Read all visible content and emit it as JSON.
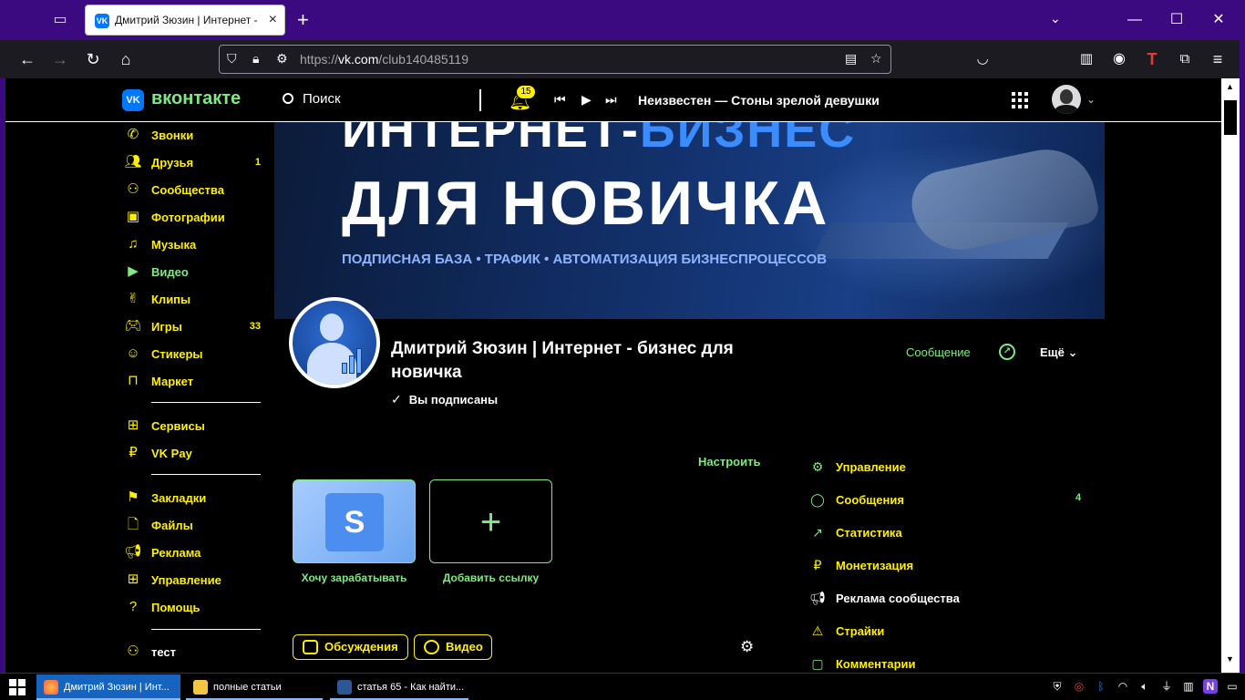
{
  "browser": {
    "tab_title": "Дмитрий Зюзин | Интернет - б",
    "new_tab": "+",
    "url_prefix": "https://",
    "url_host": "vk.com",
    "url_path": "/club140485119"
  },
  "vk": {
    "logo_text": "вконтакте",
    "search_placeholder": "Поиск",
    "notifications_count": "15",
    "now_playing": "Неизвестен — Стоны зрелой девушки"
  },
  "sidebar": {
    "items": [
      {
        "label": "Звонки",
        "icon": "phone-icon",
        "count": ""
      },
      {
        "label": "Друзья",
        "icon": "friends-icon",
        "count": "1"
      },
      {
        "label": "Сообщества",
        "icon": "communities-icon",
        "count": ""
      },
      {
        "label": "Фотографии",
        "icon": "photos-icon",
        "count": ""
      },
      {
        "label": "Музыка",
        "icon": "music-icon",
        "count": ""
      },
      {
        "label": "Видео",
        "icon": "video-icon",
        "count": ""
      },
      {
        "label": "Клипы",
        "icon": "clips-icon",
        "count": ""
      },
      {
        "label": "Игры",
        "icon": "games-icon",
        "count": "33"
      },
      {
        "label": "Стикеры",
        "icon": "stickers-icon",
        "count": ""
      },
      {
        "label": "Маркет",
        "icon": "market-icon",
        "count": ""
      }
    ],
    "items2": [
      {
        "label": "Сервисы",
        "icon": "services-icon"
      },
      {
        "label": "VK Pay",
        "icon": "vkpay-icon"
      }
    ],
    "items3": [
      {
        "label": "Закладки",
        "icon": "bookmarks-icon"
      },
      {
        "label": "Файлы",
        "icon": "files-icon"
      },
      {
        "label": "Реклама",
        "icon": "ads-icon"
      },
      {
        "label": "Управление",
        "icon": "manage-icon"
      },
      {
        "label": "Помощь",
        "icon": "help-icon"
      }
    ],
    "items4": [
      {
        "label": "тест",
        "icon": "group-icon"
      }
    ]
  },
  "cover": {
    "line1a": "ИНТЕРНЕТ-",
    "line1b": "БИЗНЕС",
    "line2": "ДЛЯ НОВИЧКА",
    "line3": "ПОДПИСНАЯ БАЗА • ТРАФИК • АВТОМАТИЗАЦИЯ БИЗНЕСПРОЦЕССОВ"
  },
  "group": {
    "name": "Дмитрий Зюзин | Интернет - бизнес для новичка",
    "subscribed": "Вы подписаны",
    "message_btn": "Сообщение",
    "more_btn": "Ещё"
  },
  "links": {
    "setup": "Настроить",
    "items": [
      {
        "caption": "Хочу зарабатывать"
      },
      {
        "caption": "Добавить ссылку"
      }
    ]
  },
  "tabs": [
    "Обсуждения",
    "Видео"
  ],
  "manage_menu": [
    {
      "label": "Управление",
      "icon": "gear-icon",
      "count": ""
    },
    {
      "label": "Сообщения",
      "icon": "chat-icon",
      "count": "4"
    },
    {
      "label": "Статистика",
      "icon": "stats-icon",
      "count": ""
    },
    {
      "label": "Монетизация",
      "icon": "ruble-icon",
      "count": ""
    },
    {
      "label": "Реклама сообщества",
      "icon": "megaphone-icon",
      "count": ""
    },
    {
      "label": "Страйки",
      "icon": "warning-icon",
      "count": ""
    },
    {
      "label": "Комментарии",
      "icon": "comment-icon",
      "count": ""
    }
  ],
  "taskbar": {
    "apps": [
      {
        "label": "Дмитрий Зюзин | Инт..."
      },
      {
        "label": "полные статьи"
      },
      {
        "label": "статья 65 - Как найти..."
      }
    ]
  },
  "colors": {
    "accent_yellow": "#fff000",
    "accent_green": "#7eea81",
    "window_frame": "#3c0a80",
    "vk_blue": "#0077ff"
  }
}
